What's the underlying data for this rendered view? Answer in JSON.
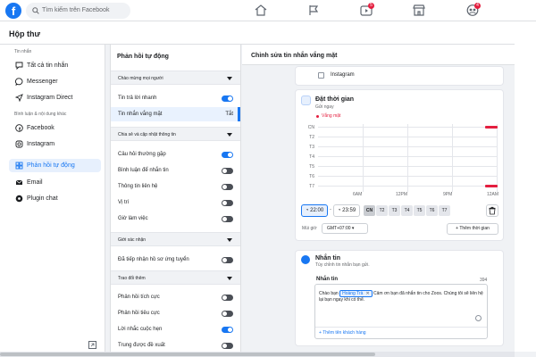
{
  "topbar": {
    "logo": "f",
    "search_placeholder": "Tìm kiếm trên Facebook",
    "nav_icons": [
      "home-icon",
      "flag-icon",
      "video-icon",
      "marketplace-icon",
      "groups-icon"
    ],
    "badges": {
      "video": "5",
      "groups": "4"
    }
  },
  "page": {
    "title": "Hộp thư"
  },
  "sidebar": {
    "section1": "Tin nhắn",
    "items1": [
      {
        "label": "Tất cả tin nhắn",
        "icon": "chat-icon"
      },
      {
        "label": "Messenger",
        "icon": "messenger-icon"
      },
      {
        "label": "Instagram Direct",
        "icon": "send-icon"
      }
    ],
    "section2": "Bình luận & nội dung khác",
    "items2": [
      {
        "label": "Facebook",
        "icon": "facebook-icon"
      },
      {
        "label": "Instagram",
        "icon": "instagram-icon"
      }
    ],
    "items3": [
      {
        "label": "Phản hồi tự động",
        "icon": "grid-icon",
        "active": true
      },
      {
        "label": "Email",
        "icon": "mail-icon"
      },
      {
        "label": "Plugin chat",
        "icon": "plugin-icon"
      }
    ]
  },
  "auto_reply": {
    "title": "Phản hồi tự động",
    "groups": [
      {
        "label": "Chào mừng mọi người"
      },
      {
        "label": "Chia sẻ và cập nhật thông tin"
      },
      {
        "label": "Giới xác nhận"
      },
      {
        "label": "Trao đổi thêm"
      }
    ],
    "rows": [
      {
        "label": "Tin trả lời nhanh",
        "on": true
      },
      {
        "label": "Tin nhắn vắng mặt",
        "value": "Tắt"
      },
      {
        "label": "Câu hỏi thường gặp",
        "on": true
      },
      {
        "label": "Bình luận để nhắn tin",
        "on": false
      },
      {
        "label": "Thông tin liên hệ",
        "on": false
      },
      {
        "label": "Vị trí",
        "on": false
      },
      {
        "label": "Giờ làm việc",
        "on": false
      },
      {
        "label": "Đã tiếp nhận hồ sơ ứng tuyển",
        "on": false
      },
      {
        "label": "Phản hồi tích cực",
        "on": false
      },
      {
        "label": "Phản hồi tiêu cực",
        "on": false
      },
      {
        "label": "Lời nhắc cuộc hẹn",
        "on": true
      },
      {
        "label": "Trung được đề xuất",
        "on": false
      }
    ]
  },
  "editor": {
    "title": "Chỉnh sửa tin nhắn vắng mặt",
    "instagram_label": "Instagram",
    "schedule": {
      "title": "Đặt thời gian",
      "subtitle": "Gửi ngay",
      "away_label": "Vắng mặt",
      "days": [
        "CN",
        "T2",
        "T3",
        "T4",
        "T5",
        "T6",
        "T7"
      ],
      "ticks": [
        "6AM",
        "12PM",
        "9PM",
        "12AM"
      ],
      "start_time": "22:00",
      "end_time": "23:59",
      "selected_day": "CN",
      "timezone_label": "Múi giờ",
      "timezone": "GMT+07:00",
      "add_time": "Thêm thời gian"
    },
    "message": {
      "title": "Nhắn tin",
      "subtitle": "Tùy chỉnh tin nhắn bạn gửi.",
      "field_label": "Nhắn tin",
      "char_count": "394",
      "text_before": "Chào bạn",
      "chip": "Hoàng Trà",
      "text_after": "Cảm ơn bạn đã nhắn tin cho Zoos. Chúng tôi sẽ liên hệ lại bạn ngay khi có thể.",
      "add_name": "+ Thêm tên khách hàng"
    }
  },
  "colors": {
    "brand": "#1877f2",
    "away": "#e41e3f",
    "badge": "#e41e3f"
  }
}
